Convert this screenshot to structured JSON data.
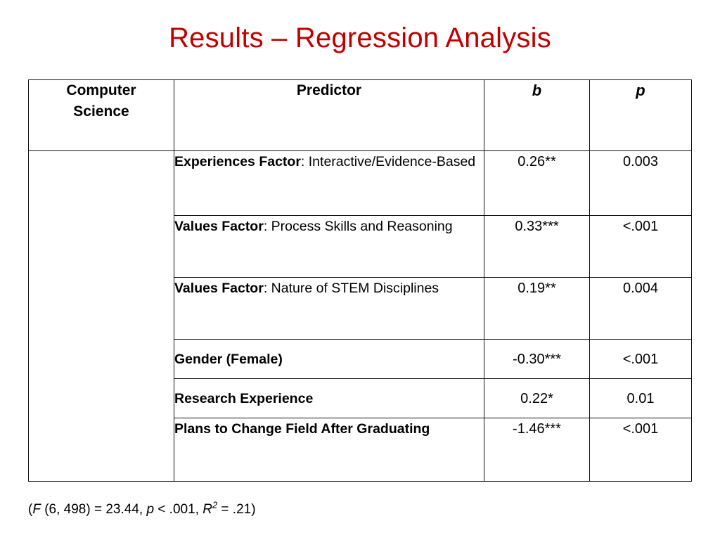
{
  "slide": {
    "title": "Results – Regression Analysis",
    "title_color": "#C00000",
    "background_color": "#FFFFFF"
  },
  "table": {
    "headers": {
      "group": "Computer Science",
      "group_line1": "Computer",
      "group_line2": "Science",
      "predictor": "Predictor",
      "b": "b",
      "p": "p"
    },
    "rows": [
      {
        "predictor_bold": "Experiences Factor",
        "predictor_rest": ": Interactive/Evidence-Based",
        "predictor_full": "Experiences Factor: Interactive/Evidence-Based",
        "b": "0.26**",
        "p": "0.003"
      },
      {
        "predictor_bold": "Values Factor",
        "predictor_rest": ": Process Skills and Reasoning",
        "predictor_full": "Values Factor: Process Skills and Reasoning",
        "b": "0.33***",
        "p": "<.001"
      },
      {
        "predictor_bold": "Values Factor",
        "predictor_rest": ": Nature of STEM Disciplines",
        "predictor_full": "Values Factor: Nature of STEM Disciplines",
        "b": "0.19**",
        "p": "0.004"
      },
      {
        "predictor_bold": "Gender (Female)",
        "predictor_rest": "",
        "predictor_full": "Gender (Female)",
        "b": "-0.30***",
        "p": "<.001"
      },
      {
        "predictor_bold": "Research Experience",
        "predictor_rest": "",
        "predictor_full": "Research Experience",
        "b": "0.22*",
        "p": "0.01"
      },
      {
        "predictor_bold": "Plans to Change Field After Graduating",
        "predictor_rest": "",
        "predictor_full": "Plans to Change Field After Graduating",
        "b": "-1.46***",
        "p": "<.001"
      }
    ]
  },
  "footnote": {
    "open_paren": "(",
    "f_symbol": "F",
    "f_detail": " (6, 498) = 23.44, ",
    "p_symbol": "p",
    "p_detail": " < .001, ",
    "r_symbol": "R",
    "r_exponent": "2",
    "r_detail": " = .21)",
    "full_text": "(F (6, 498) = 23.44, p < .001, R2 = .21)"
  }
}
